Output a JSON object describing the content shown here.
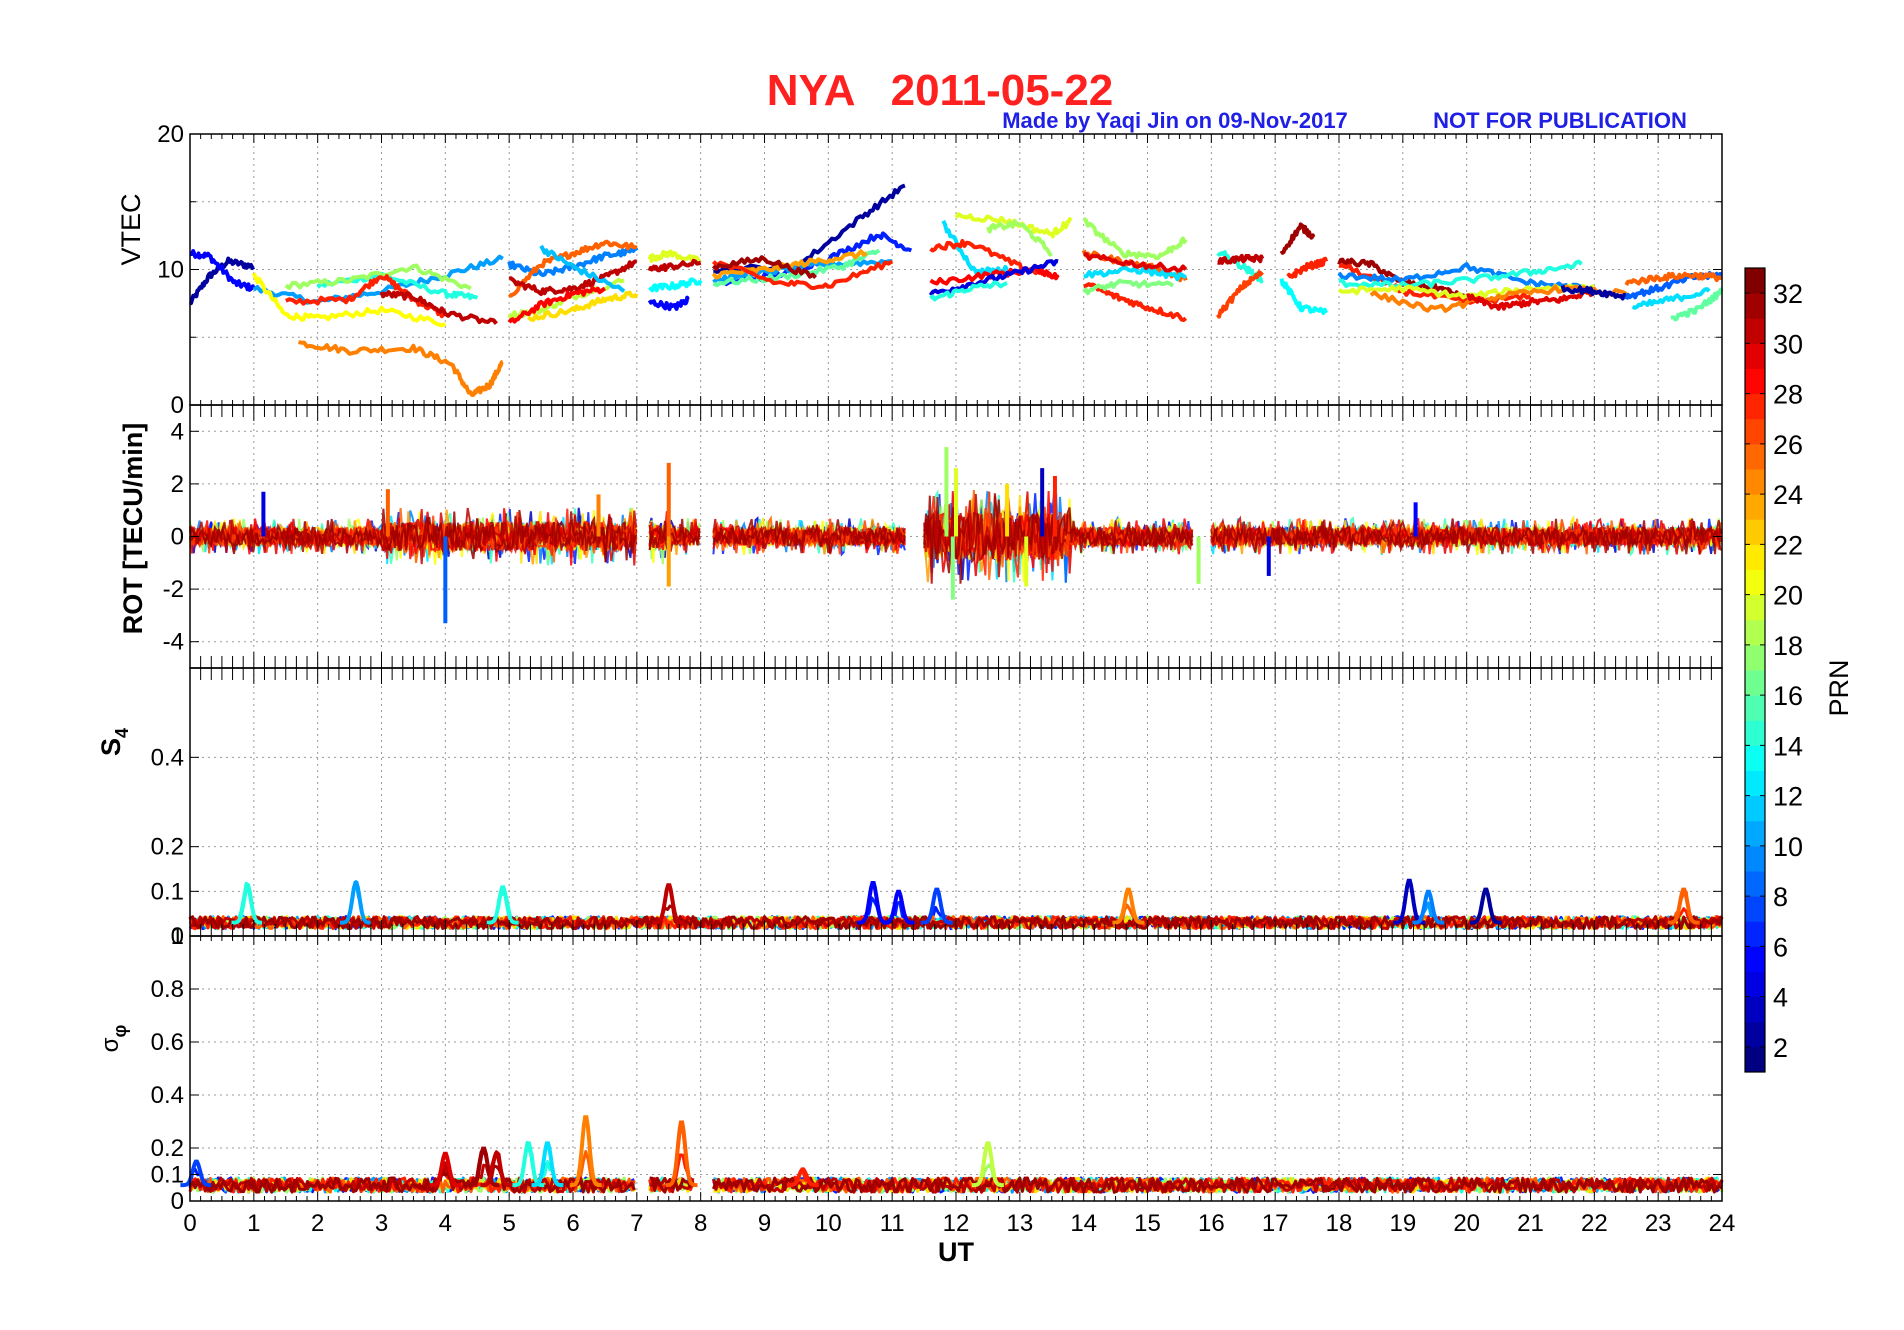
{
  "title": "NYA   2011-05-22",
  "credit": "Made by Yaqi Jin on 09-Nov-2017",
  "notice": "NOT FOR PUBLICATION",
  "colors": {
    "title": "#ff2020",
    "credit": "#1f1fe6",
    "grid": "#9a9a9a"
  },
  "chart_data": [
    {
      "type": "line",
      "id": "vtec",
      "ylabel": "VTEC",
      "ylim": [
        0,
        20
      ],
      "yticks": [
        0,
        10,
        20
      ],
      "xlim": [
        0,
        24
      ],
      "grid": true,
      "series": [
        {
          "prn": 2,
          "x": [
            0.0,
            0.3,
            0.6,
            1.0
          ],
          "values": [
            7.5,
            9.5,
            10.6,
            10.2
          ]
        },
        {
          "prn": 5,
          "x": [
            0.0,
            0.3,
            0.7,
            1.0
          ],
          "values": [
            11.2,
            11.0,
            9.0,
            8.6
          ]
        },
        {
          "prn": 10,
          "x": [
            1.0,
            2.0,
            3.0,
            4.0,
            4.9
          ],
          "values": [
            8.6,
            7.6,
            8.4,
            9.6,
            10.8
          ]
        },
        {
          "prn": 14,
          "x": [
            2.0,
            3.0,
            4.0,
            4.5
          ],
          "values": [
            8.8,
            9.6,
            8.2,
            7.9
          ]
        },
        {
          "prn": 18,
          "x": [
            1.5,
            2.5,
            3.5,
            4.4
          ],
          "values": [
            8.8,
            9.2,
            10.2,
            8.6
          ]
        },
        {
          "prn": 21,
          "x": [
            1.0,
            1.5,
            2.0,
            3.0,
            4.0
          ],
          "values": [
            9.6,
            6.6,
            6.4,
            7.0,
            6.0
          ]
        },
        {
          "prn": 25,
          "x": [
            1.7,
            2.5,
            3.5,
            4.1,
            4.4,
            4.7,
            4.9
          ],
          "values": [
            4.6,
            4.0,
            4.2,
            3.0,
            0.7,
            1.5,
            3.2
          ]
        },
        {
          "prn": 28,
          "x": [
            1.5,
            2.5,
            3.0,
            3.5,
            4.0
          ],
          "values": [
            7.6,
            7.8,
            9.6,
            7.8,
            6.6
          ]
        },
        {
          "prn": 31,
          "x": [
            3.0,
            3.5,
            4.0,
            4.8
          ],
          "values": [
            8.2,
            8.0,
            6.8,
            6.0
          ]
        },
        {
          "prn": 9,
          "x": [
            5.0,
            5.5,
            6.0,
            6.5,
            7.0
          ],
          "values": [
            10.4,
            9.6,
            10.2,
            11.0,
            11.4
          ]
        },
        {
          "prn": 26,
          "x": [
            5.0,
            5.5,
            6.0,
            6.5,
            7.0
          ],
          "values": [
            8.0,
            10.4,
            11.2,
            12.0,
            11.6
          ]
        },
        {
          "prn": 19,
          "x": [
            5.0,
            5.5,
            6.0,
            6.8
          ],
          "values": [
            6.6,
            7.0,
            8.0,
            9.2
          ]
        },
        {
          "prn": 22,
          "x": [
            5.3,
            6.0,
            6.5,
            7.0
          ],
          "values": [
            6.4,
            7.0,
            7.8,
            8.2
          ]
        },
        {
          "prn": 31,
          "x": [
            5.0,
            5.5,
            6.0,
            6.5,
            7.0
          ],
          "values": [
            9.2,
            8.4,
            8.6,
            9.4,
            10.6
          ]
        },
        {
          "prn": 29,
          "x": [
            5.0,
            5.5,
            6.0,
            6.5
          ],
          "values": [
            6.0,
            7.4,
            8.2,
            8.6
          ]
        },
        {
          "prn": 11,
          "x": [
            5.5,
            6.0,
            6.8
          ],
          "values": [
            11.6,
            10.2,
            8.4
          ]
        },
        {
          "prn": 5,
          "x": [
            7.2,
            7.6,
            7.8
          ],
          "values": [
            7.6,
            7.2,
            7.8
          ]
        },
        {
          "prn": 20,
          "x": [
            7.2,
            7.5,
            8.0
          ],
          "values": [
            10.8,
            11.2,
            10.6
          ]
        },
        {
          "prn": 31,
          "x": [
            7.2,
            7.5,
            8.0
          ],
          "values": [
            10.0,
            10.2,
            10.5
          ]
        },
        {
          "prn": 13,
          "x": [
            7.2,
            7.6,
            8.0
          ],
          "values": [
            8.6,
            8.8,
            9.2
          ]
        },
        {
          "prn": 2,
          "x": [
            8.2,
            9.5,
            10.5,
            11.2
          ],
          "values": [
            10.0,
            10.2,
            13.8,
            16.2
          ]
        },
        {
          "prn": 6,
          "x": [
            8.3,
            9.2,
            10.0,
            10.8,
            11.3
          ],
          "values": [
            9.0,
            9.6,
            10.8,
            12.6,
            11.4
          ]
        },
        {
          "prn": 10,
          "x": [
            8.2,
            9.0,
            10.0,
            11.0
          ],
          "values": [
            9.2,
            9.8,
            10.4,
            10.6
          ]
        },
        {
          "prn": 16,
          "x": [
            8.2,
            9.2,
            10.2,
            10.8
          ],
          "values": [
            9.0,
            9.4,
            10.2,
            11.4
          ]
        },
        {
          "prn": 24,
          "x": [
            8.2,
            9.0,
            9.8,
            10.6
          ],
          "values": [
            9.6,
            10.0,
            10.6,
            11.2
          ]
        },
        {
          "prn": 28,
          "x": [
            8.2,
            9.2,
            10.0,
            11.0
          ],
          "values": [
            10.6,
            9.0,
            8.8,
            10.6
          ]
        },
        {
          "prn": 32,
          "x": [
            8.2,
            9.0,
            9.8
          ],
          "values": [
            10.2,
            10.8,
            9.4
          ]
        },
        {
          "prn": 20,
          "x": [
            12.0,
            12.8,
            13.5,
            13.8
          ],
          "values": [
            14.0,
            13.6,
            12.6,
            13.6
          ]
        },
        {
          "prn": 18,
          "x": [
            12.5,
            13.0,
            13.5
          ],
          "values": [
            13.0,
            13.4,
            11.2
          ]
        },
        {
          "prn": 12,
          "x": [
            11.8,
            12.3,
            12.8
          ],
          "values": [
            13.4,
            9.8,
            10.0
          ]
        },
        {
          "prn": 28,
          "x": [
            11.6,
            12.2,
            13.0,
            13.5
          ],
          "values": [
            11.6,
            12.0,
            10.2,
            9.6
          ]
        },
        {
          "prn": 29,
          "x": [
            11.6,
            12.5,
            13.3,
            13.6
          ],
          "values": [
            9.0,
            9.6,
            10.0,
            9.4
          ]
        },
        {
          "prn": 4,
          "x": [
            11.6,
            12.3,
            13.0,
            13.6
          ],
          "values": [
            8.2,
            9.0,
            9.8,
            10.6
          ]
        },
        {
          "prn": 14,
          "x": [
            11.6,
            12.2,
            12.8
          ],
          "values": [
            7.8,
            8.6,
            9.0
          ]
        },
        {
          "prn": 18,
          "x": [
            14.0,
            14.6,
            15.2,
            15.6
          ],
          "values": [
            13.6,
            11.2,
            11.0,
            12.2
          ]
        },
        {
          "prn": 26,
          "x": [
            14.0,
            14.6,
            15.2,
            15.6
          ],
          "values": [
            11.2,
            10.6,
            10.0,
            9.2
          ]
        },
        {
          "prn": 28,
          "x": [
            14.0,
            14.5,
            15.0,
            15.6
          ],
          "values": [
            9.0,
            8.0,
            7.2,
            6.4
          ]
        },
        {
          "prn": 12,
          "x": [
            14.0,
            14.8,
            15.6
          ],
          "values": [
            9.6,
            10.0,
            9.4
          ]
        },
        {
          "prn": 30,
          "x": [
            14.0,
            14.8,
            15.6
          ],
          "values": [
            11.0,
            10.4,
            10.0
          ]
        },
        {
          "prn": 17,
          "x": [
            14.0,
            14.6,
            15.4
          ],
          "values": [
            8.4,
            9.0,
            8.8
          ]
        },
        {
          "prn": 14,
          "x": [
            16.1,
            16.5,
            16.8
          ],
          "values": [
            11.4,
            10.2,
            9.2
          ]
        },
        {
          "prn": 31,
          "x": [
            16.1,
            16.5,
            16.8
          ],
          "values": [
            10.6,
            10.8,
            10.8
          ]
        },
        {
          "prn": 27,
          "x": [
            16.1,
            16.5,
            16.8
          ],
          "values": [
            6.6,
            8.8,
            9.8
          ]
        },
        {
          "prn": 32,
          "x": [
            17.1,
            17.4,
            17.6
          ],
          "values": [
            11.2,
            13.2,
            12.4
          ]
        },
        {
          "prn": 13,
          "x": [
            17.1,
            17.4,
            17.8
          ],
          "values": [
            9.2,
            7.2,
            6.8
          ]
        },
        {
          "prn": 28,
          "x": [
            17.2,
            17.5,
            17.8
          ],
          "values": [
            9.4,
            10.2,
            10.6
          ]
        },
        {
          "prn": 32,
          "x": [
            18.0,
            18.5,
            19.0,
            19.6,
            20.0
          ],
          "values": [
            10.6,
            10.4,
            9.0,
            8.6,
            7.8
          ]
        },
        {
          "prn": 28,
          "x": [
            18.0,
            19.0,
            20.0,
            21.0
          ],
          "values": [
            10.4,
            8.4,
            7.6,
            8.0
          ]
        },
        {
          "prn": 9,
          "x": [
            18.0,
            19.0,
            20.0,
            21.0,
            22.0
          ],
          "values": [
            9.6,
            9.2,
            10.2,
            9.0,
            8.6
          ]
        },
        {
          "prn": 14,
          "x": [
            18.0,
            19.0,
            20.0,
            21.0,
            21.8
          ],
          "values": [
            9.0,
            8.8,
            9.2,
            9.8,
            10.4
          ]
        },
        {
          "prn": 20,
          "x": [
            18.0,
            19.0,
            20.0,
            21.0,
            22.0
          ],
          "values": [
            8.4,
            8.6,
            8.0,
            8.6,
            8.8
          ]
        },
        {
          "prn": 25,
          "x": [
            18.5,
            19.5,
            20.5,
            21.5,
            22.5
          ],
          "values": [
            8.2,
            7.0,
            8.0,
            8.6,
            8.2
          ]
        },
        {
          "prn": 30,
          "x": [
            20.0,
            20.5,
            21.0,
            21.5,
            22.0
          ],
          "values": [
            8.0,
            7.2,
            7.6,
            7.8,
            8.4
          ]
        },
        {
          "prn": 2,
          "x": [
            21.5,
            22.0,
            22.5
          ],
          "values": [
            8.6,
            8.4,
            8.0
          ]
        },
        {
          "prn": 8,
          "x": [
            22.5,
            23.0,
            23.5,
            24.0
          ],
          "values": [
            8.0,
            8.6,
            9.4,
            9.6
          ]
        },
        {
          "prn": 26,
          "x": [
            22.5,
            23.0,
            23.5,
            24.0
          ],
          "values": [
            9.0,
            9.4,
            9.6,
            9.4
          ]
        },
        {
          "prn": 12,
          "x": [
            22.6,
            23.2,
            23.8
          ],
          "values": [
            7.2,
            7.8,
            8.4
          ]
        },
        {
          "prn": 16,
          "x": [
            23.2,
            23.6,
            24.0
          ],
          "values": [
            6.4,
            7.0,
            8.4
          ]
        }
      ]
    },
    {
      "type": "scatter",
      "id": "rot",
      "ylabel": "ROT [TECU/min]",
      "ylim": [
        -5,
        5
      ],
      "yticks": [
        -4,
        -2,
        0,
        2,
        4
      ],
      "xlim": [
        0,
        24
      ],
      "grid": true,
      "spikes": [
        {
          "x": 7.5,
          "y": 2.8,
          "prn": 26
        },
        {
          "x": 11.85,
          "y": 3.4,
          "prn": 18
        },
        {
          "x": 12.0,
          "y": 2.6,
          "prn": 20
        },
        {
          "x": 13.35,
          "y": 2.6,
          "prn": 3
        },
        {
          "x": 13.55,
          "y": 2.3,
          "prn": 28
        },
        {
          "x": 12.8,
          "y": 2.0,
          "prn": 22
        },
        {
          "x": 4.0,
          "y": -3.3,
          "prn": 8
        },
        {
          "x": 11.95,
          "y": -2.4,
          "prn": 17
        },
        {
          "x": 7.5,
          "y": -1.9,
          "prn": 24
        },
        {
          "x": 15.8,
          "y": -1.8,
          "prn": 18
        },
        {
          "x": 3.1,
          "y": 1.8,
          "prn": 26
        },
        {
          "x": 1.15,
          "y": 1.7,
          "prn": 4
        },
        {
          "x": 6.4,
          "y": 1.6,
          "prn": 25
        },
        {
          "x": 19.2,
          "y": 1.3,
          "prn": 5
        },
        {
          "x": 16.9,
          "y": -1.5,
          "prn": 4
        },
        {
          "x": 13.1,
          "y": -1.9,
          "prn": 20
        }
      ]
    },
    {
      "type": "line",
      "id": "s4",
      "ylabel": "S4",
      "ylim": [
        0,
        0.6
      ],
      "yticks": [
        0,
        0.1,
        0.2,
        0.4
      ],
      "xlim": [
        0,
        24
      ],
      "grid": true,
      "peaks": [
        {
          "x": 0.9,
          "y": 0.11,
          "prn": 14
        },
        {
          "x": 2.6,
          "y": 0.12,
          "prn": 10
        },
        {
          "x": 4.9,
          "y": 0.11,
          "prn": 14
        },
        {
          "x": 7.5,
          "y": 0.115,
          "prn": 31
        },
        {
          "x": 10.7,
          "y": 0.12,
          "prn": 5
        },
        {
          "x": 11.1,
          "y": 0.1,
          "prn": 5
        },
        {
          "x": 11.7,
          "y": 0.105,
          "prn": 7
        },
        {
          "x": 14.7,
          "y": 0.105,
          "prn": 25
        },
        {
          "x": 19.1,
          "y": 0.125,
          "prn": 3
        },
        {
          "x": 19.4,
          "y": 0.1,
          "prn": 9
        },
        {
          "x": 20.3,
          "y": 0.105,
          "prn": 2
        },
        {
          "x": 23.4,
          "y": 0.105,
          "prn": 26
        }
      ],
      "baseline": 0.03
    },
    {
      "type": "line",
      "id": "sigma",
      "ylabel": "σφ",
      "ylim": [
        0,
        1
      ],
      "yticks": [
        0,
        0.1,
        0.2,
        0.4,
        0.6,
        0.8,
        1
      ],
      "xlim": [
        0,
        24
      ],
      "xticks": [
        0,
        1,
        2,
        3,
        4,
        5,
        6,
        7,
        8,
        9,
        10,
        11,
        12,
        13,
        14,
        15,
        16,
        17,
        18,
        19,
        20,
        21,
        22,
        23,
        24
      ],
      "xlabel": "UT",
      "grid": true,
      "peaks": [
        {
          "x": 4.6,
          "y": 0.2,
          "prn": 32
        },
        {
          "x": 4.8,
          "y": 0.18,
          "prn": 31
        },
        {
          "x": 5.3,
          "y": 0.22,
          "prn": 14
        },
        {
          "x": 5.6,
          "y": 0.22,
          "prn": 12
        },
        {
          "x": 6.2,
          "y": 0.32,
          "prn": 25
        },
        {
          "x": 7.7,
          "y": 0.3,
          "prn": 26
        },
        {
          "x": 12.5,
          "y": 0.22,
          "prn": 19
        },
        {
          "x": 4.0,
          "y": 0.18,
          "prn": 30
        },
        {
          "x": 0.1,
          "y": 0.15,
          "prn": 7
        },
        {
          "x": 9.6,
          "y": 0.12,
          "prn": 28
        }
      ],
      "baseline": 0.06
    },
    {
      "type": "heatmap",
      "id": "colorbar",
      "label": "PRN",
      "range": [
        1,
        33
      ],
      "ticks": [
        2,
        4,
        6,
        8,
        10,
        12,
        14,
        16,
        18,
        20,
        22,
        24,
        26,
        28,
        30,
        32
      ],
      "colormap": "jet",
      "levels": 32
    }
  ]
}
